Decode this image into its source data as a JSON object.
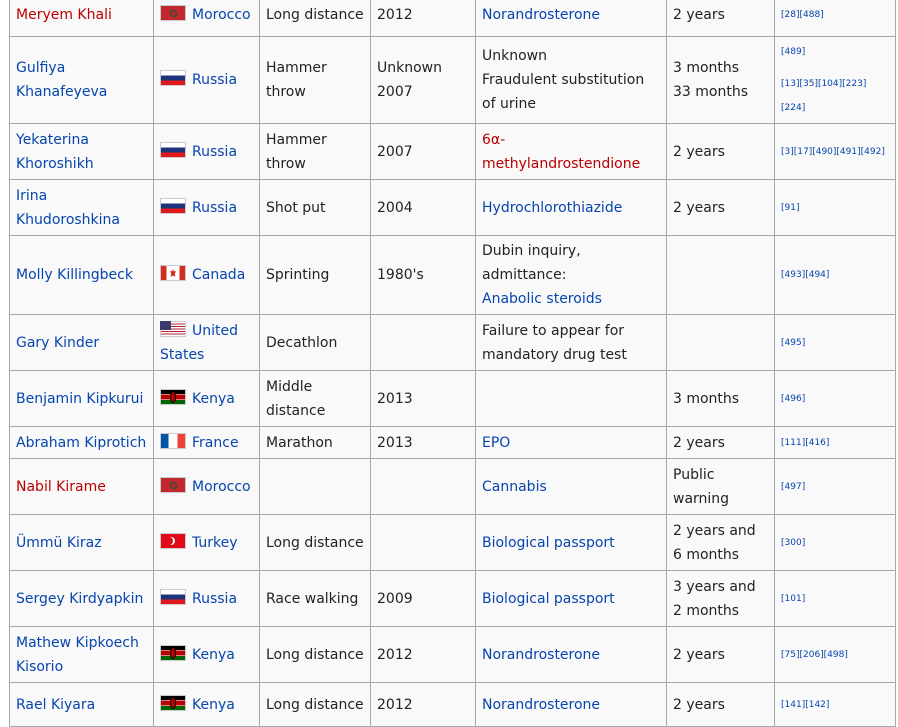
{
  "rows": [
    {
      "athlete": "Meryem Khali",
      "athlete_red": true,
      "country": "Morocco",
      "flag_icon": "morocco-flag-icon",
      "event": "Long distance",
      "year": "2012",
      "sub": [
        "Norandrosterone"
      ],
      "sub_link": [
        true
      ],
      "penalty": [
        "2 years"
      ],
      "refs": [
        "[28][488]"
      ]
    },
    {
      "athlete": "Gulfiya Khanafeyeva",
      "athlete_red": false,
      "country": "Russia",
      "flag_icon": "russia-flag-icon",
      "event": "Hammer throw",
      "year": "Unknown 2007",
      "sub": [
        "Unknown",
        "Fraudulent substitution of urine"
      ],
      "sub_link": [
        false,
        false
      ],
      "penalty": [
        "3 months",
        "33 months"
      ],
      "refs": [
        "[489]",
        "[13][35][104][223][224]"
      ]
    },
    {
      "athlete": "Yekaterina Khoroshikh",
      "athlete_red": false,
      "country": "Russia",
      "flag_icon": "russia-flag-icon",
      "event": "Hammer throw",
      "year": "2007",
      "sub": [
        "6α-methylandrostendione"
      ],
      "sub_link": [
        "red"
      ],
      "penalty": [
        "2 years"
      ],
      "refs": [
        "[3][17][490][491][492]"
      ]
    },
    {
      "athlete": "Irina Khudoroshkina",
      "athlete_red": false,
      "country": "Russia",
      "flag_icon": "russia-flag-icon",
      "event": "Shot put",
      "year": "2004",
      "sub": [
        "Hydrochlorothiazide"
      ],
      "sub_link": [
        true
      ],
      "penalty": [
        "2 years"
      ],
      "refs": [
        "[91]"
      ]
    },
    {
      "athlete": "Molly Killingbeck",
      "athlete_red": false,
      "country": "Canada",
      "flag_icon": "canada-flag-icon",
      "event": "Sprinting",
      "year": "1980's",
      "sub": [
        "Dubin inquiry, admittance:",
        "Anabolic steroids"
      ],
      "sub_link": [
        false,
        true
      ],
      "penalty": [
        ""
      ],
      "refs": [
        "[493][494]"
      ]
    },
    {
      "athlete": "Gary Kinder",
      "athlete_red": false,
      "country": "United States",
      "flag_icon": "usa-flag-icon",
      "event": "Decathlon",
      "year": "",
      "sub": [
        "Failure to appear for mandatory drug test"
      ],
      "sub_link": [
        false
      ],
      "penalty": [
        ""
      ],
      "refs": [
        "[495]"
      ]
    },
    {
      "athlete": "Benjamin Kipkurui",
      "athlete_red": false,
      "country": "Kenya",
      "flag_icon": "kenya-flag-icon",
      "event": "Middle distance",
      "year": "2013",
      "sub": [
        ""
      ],
      "sub_link": [
        false
      ],
      "penalty": [
        "3 months"
      ],
      "refs": [
        "[496]"
      ]
    },
    {
      "athlete": "Abraham Kiprotich",
      "athlete_red": false,
      "country": "France",
      "flag_icon": "france-flag-icon",
      "event": "Marathon",
      "year": "2013",
      "sub": [
        "EPO"
      ],
      "sub_link": [
        true
      ],
      "penalty": [
        "2 years"
      ],
      "refs": [
        "[111][416]"
      ]
    },
    {
      "athlete": "Nabil Kirame",
      "athlete_red": true,
      "country": "Morocco",
      "flag_icon": "morocco-flag-icon",
      "event": "",
      "year": "",
      "sub": [
        "Cannabis"
      ],
      "sub_link": [
        true
      ],
      "penalty": [
        "Public warning"
      ],
      "refs": [
        "[497]"
      ]
    },
    {
      "athlete": "Ümmü Kiraz",
      "athlete_red": false,
      "country": "Turkey",
      "flag_icon": "turkey-flag-icon",
      "event": "Long distance",
      "year": "",
      "sub": [
        "Biological passport"
      ],
      "sub_link": [
        true
      ],
      "penalty": [
        "2 years and 6 months"
      ],
      "refs": [
        "[300]"
      ]
    },
    {
      "athlete": "Sergey Kirdyapkin",
      "athlete_red": false,
      "country": "Russia",
      "flag_icon": "russia-flag-icon",
      "event": "Race walking",
      "year": "2009",
      "sub": [
        "Biological passport"
      ],
      "sub_link": [
        true
      ],
      "penalty": [
        "3 years and 2 months"
      ],
      "refs": [
        "[101]"
      ]
    },
    {
      "athlete": "Mathew Kipkoech Kisorio",
      "athlete_red": false,
      "country": "Kenya",
      "flag_icon": "kenya-flag-icon",
      "event": "Long distance",
      "year": "2012",
      "sub": [
        "Norandrosterone"
      ],
      "sub_link": [
        true
      ],
      "penalty": [
        "2 years"
      ],
      "refs": [
        "[75][206][498]"
      ]
    },
    {
      "athlete": "Rael Kiyara",
      "athlete_red": false,
      "country": "Kenya",
      "flag_icon": "kenya-flag-icon",
      "event": "Long distance",
      "year": "2012",
      "sub": [
        "Norandrosterone"
      ],
      "sub_link": [
        true
      ],
      "penalty": [
        "2 years"
      ],
      "refs": [
        "[141][142]"
      ]
    }
  ],
  "colors": {
    "link": "#0645ad",
    "redlink": "#ba0000",
    "border": "#a2a9b1",
    "cell_bg": "#f9f9f9"
  }
}
